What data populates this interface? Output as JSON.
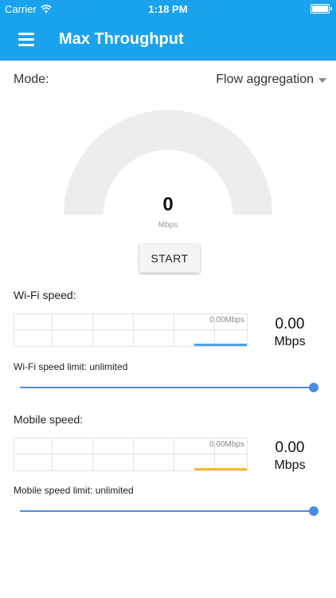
{
  "status_bar": {
    "carrier": "Carrier",
    "time": "1:18 PM"
  },
  "app_bar": {
    "title": "Max Throughput",
    "menu_icon": "hamburger-menu-icon"
  },
  "mode": {
    "label": "Mode:",
    "selected": "Flow aggregation"
  },
  "gauge": {
    "value": "0",
    "unit": "Mbps"
  },
  "start_button": {
    "label": "START"
  },
  "wifi": {
    "section_label": "Wi-Fi speed:",
    "graph_label": "0.00Mbps",
    "value": "0.00",
    "unit": "Mbps",
    "limit_label": "Wi-Fi speed limit: unlimited",
    "line_color": "#4aa3ea"
  },
  "mobile": {
    "section_label": "Mobile speed:",
    "graph_label": "0.00Mbps",
    "value": "0.00",
    "unit": "Mbps",
    "limit_label": "Mobile speed limit: unlimited",
    "line_color": "#f5b92e"
  },
  "colors": {
    "primary": "#1aa3ec",
    "slider": "#4a8de0",
    "gauge_track": "#ededed"
  }
}
